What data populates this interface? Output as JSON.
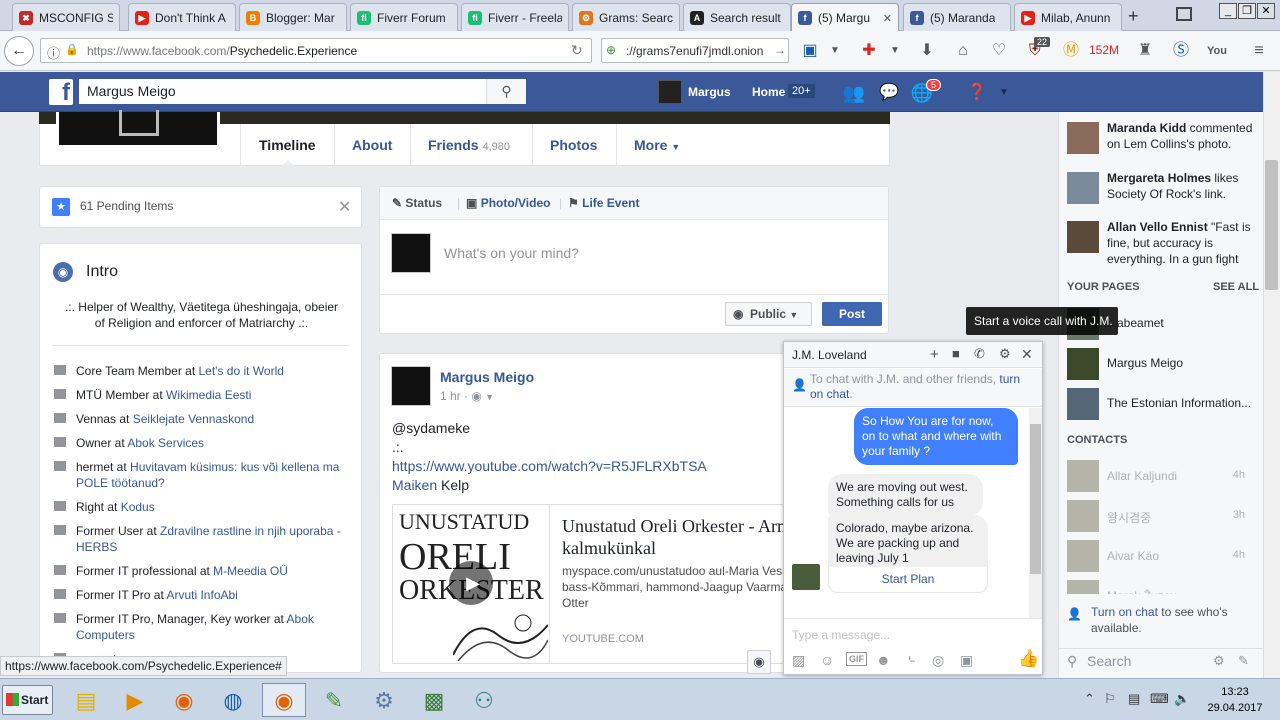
{
  "browser": {
    "tabs": [
      {
        "label": "MSCONFIG S",
        "color": "#c62828",
        "glyph": "✖"
      },
      {
        "label": "Don't Think A",
        "color": "#e62117",
        "glyph": "▶"
      },
      {
        "label": "Blogger: Mar",
        "color": "#f57d00",
        "glyph": "B"
      },
      {
        "label": "Fiverr Forum",
        "color": "#1dbf73",
        "glyph": "fi"
      },
      {
        "label": "Fiverr - Freela",
        "color": "#1dbf73",
        "glyph": "fi"
      },
      {
        "label": "Grams: Searc",
        "color": "#e8711c",
        "glyph": "⚙"
      },
      {
        "label": "Search result",
        "color": "#222222",
        "glyph": "A"
      },
      {
        "label": "(5) Margu",
        "color": "#3b5998",
        "glyph": "f"
      },
      {
        "label": "(5) Maranda",
        "color": "#3b5998",
        "glyph": "f"
      },
      {
        "label": "Milab, Anunn",
        "color": "#e62117",
        "glyph": "▶"
      }
    ],
    "url_host": "https://www.facebook.com/",
    "url_path": "Psychedelic.Experience",
    "search_text": "://grams7enufi7jmdl.onion",
    "download_count": "152M",
    "addon_badge": "22",
    "status_url": "https://www.facebook.com/Psychedelic.Experience#"
  },
  "fb_header": {
    "logo": "f",
    "search_value": "Margus Meigo",
    "user_name": "Margus",
    "home_label": "Home",
    "home_badge": "20+",
    "notif_badge": "5"
  },
  "profile_tabs": {
    "timeline": "Timeline",
    "about": "About",
    "friends": "Friends",
    "friends_count": "4,980",
    "photos": "Photos",
    "more": "More"
  },
  "pending": {
    "label": "61 Pending Items"
  },
  "intro": {
    "title": "Intro",
    "bio": ".:. Helper of Wealthy, Väetitega üheshingaja, obeier of Religion and enforcer of Matriarchy .:.",
    "work": [
      {
        "role": "Core Team Member at ",
        "org": "Let's do it World"
      },
      {
        "role": "MTÜ Member at ",
        "org": "Wikimedia Eesti"
      },
      {
        "role": "Vennas at ",
        "org": "Seiklejate Vennaskond"
      },
      {
        "role": "Owner at ",
        "org": "Abok Services"
      },
      {
        "role": "hermet at ",
        "org": "Huvitavam küsimus: kus või kellena ma POLE töötanud?"
      },
      {
        "role": "Right at ",
        "org": "Kodus"
      },
      {
        "role": "Former User at ",
        "org": "Zdravilne rastline in njih uporaba - HERBS"
      },
      {
        "role": "Former IT professional at ",
        "org": "M-Meedia OÜ"
      },
      {
        "role": "Former IT Pro at ",
        "org": "Arvuti InfoAbi"
      },
      {
        "role": "Former IT Pro, Manager, Key worker at ",
        "org": "Abok Computers"
      },
      {
        "role": "support",
        "org": ""
      }
    ]
  },
  "composer": {
    "tab_status": "Status",
    "tab_photo": "Photo/Video",
    "tab_life": "Life Event",
    "placeholder": "What's on your mind?",
    "privacy": "Public",
    "post_label": "Post"
  },
  "post": {
    "author": "Margus Meigo",
    "time": "1 hr · ",
    "line1": "@sydameke",
    "line2": ".:.",
    "link": "https://www.youtube.com/watch?v=R5JFLRXbTSA",
    "mention": "Maiken",
    "mention_rest": " Kelp",
    "card_title": "Unustatud Oreli Orkester - Armastuse kalmukünkal",
    "card_desc": "myspace.com/unustatudoo aul-Maria Vesiallik, kitarr-Elmu Värk, bass-Kõmmari, hammond-Jaagup Vaarmann, trummid - Kristo Otter",
    "card_domain": "YOUTUBE.COM",
    "thumb_line1": "UNUSTATUD",
    "thumb_line2": "ORELI",
    "thumb_line3": "ORKESTER"
  },
  "ticker": [
    {
      "name": "Maranda Kidd",
      "text": " commented on Lem Collins's photo."
    },
    {
      "name": "Mergareta Holmes",
      "text": " likes Society Of Rock's link."
    },
    {
      "name": "Allan Vello Ennist",
      "text": " \"Fast is fine, but accuracy is everything. In a gun fight"
    }
  ],
  "your_pages": {
    "header": "YOUR PAGES",
    "see_all": "SEE ALL",
    "items": [
      "...abeamet",
      "Margus Meigo",
      "The Estonian Information..."
    ]
  },
  "contacts": {
    "header": "CONTACTS",
    "items": [
      {
        "name": "Allar Kaljundi",
        "time": "4h"
      },
      {
        "name": "왕시겸중",
        "time": "3h"
      },
      {
        "name": "Aivar Käo",
        "time": "4h"
      },
      {
        "name": "Marek Žuzov",
        "time": ""
      }
    ],
    "turn_on_link": "Turn on chat",
    "turn_on_rest": " to see who's available.",
    "search_placeholder": "Search"
  },
  "chat": {
    "name": "J.M. Loveland",
    "note_text": "To chat with J.M. and other friends, ",
    "note_link": "turn on chat",
    "note_end": ".",
    "msg_me": "So How You are for now, on to what and where with your family ?",
    "msg_them1": "We are moving out west. Something calls for us",
    "msg_them2": "Colorado, maybe arizona. We are packing up and leaving July 1",
    "start_plan": "Start Plan",
    "input_placeholder": "Type a message...",
    "tooltip": "Start a voice call with J.M."
  },
  "taskbar": {
    "start": "Start",
    "time": "13:23",
    "date": "29.04.2017"
  }
}
